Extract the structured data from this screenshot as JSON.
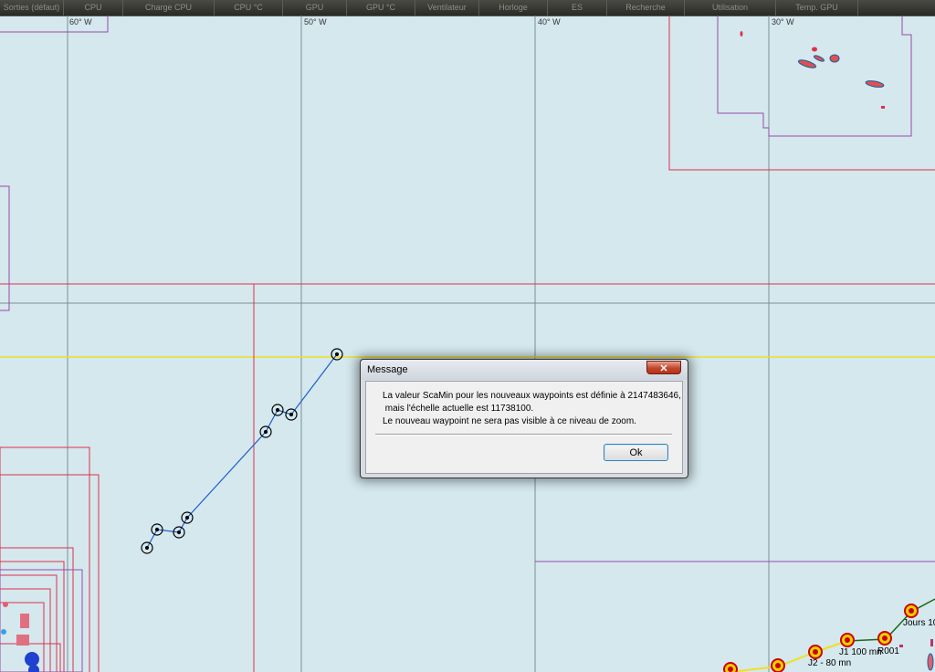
{
  "status_bar": {
    "segments": [
      "Sorties (défaut)",
      "CPU",
      "Charge CPU",
      "CPU °C",
      "GPU",
      "GPU °C",
      "Ventilateur",
      "Horloge",
      "ES",
      "Recherche",
      "Utilisation",
      "Temp. GPU"
    ]
  },
  "chart": {
    "longitude_labels": [
      "60° W",
      "50° W",
      "40° W",
      "30° W"
    ],
    "route_color": "#1f5fc8",
    "grid_color": "#7a8f98",
    "boundary_red": "#e0304a",
    "boundary_purple": "#9a4aa8",
    "latitude_line_color": "#f0e020",
    "waypoint_labels": [
      "Jours 10",
      "J1 100 mn",
      "R001",
      "J2 - 80 mn"
    ]
  },
  "dialog": {
    "title": "Message",
    "close_label": "✕",
    "message_lines": [
      "La valeur ScaMin pour les nouveaux waypoints est définie à 2147483646,",
      " mais l'échelle actuelle est 11738100.",
      "Le nouveau waypoint ne sera pas visible à ce niveau de zoom."
    ],
    "ok_label": "Ok"
  }
}
